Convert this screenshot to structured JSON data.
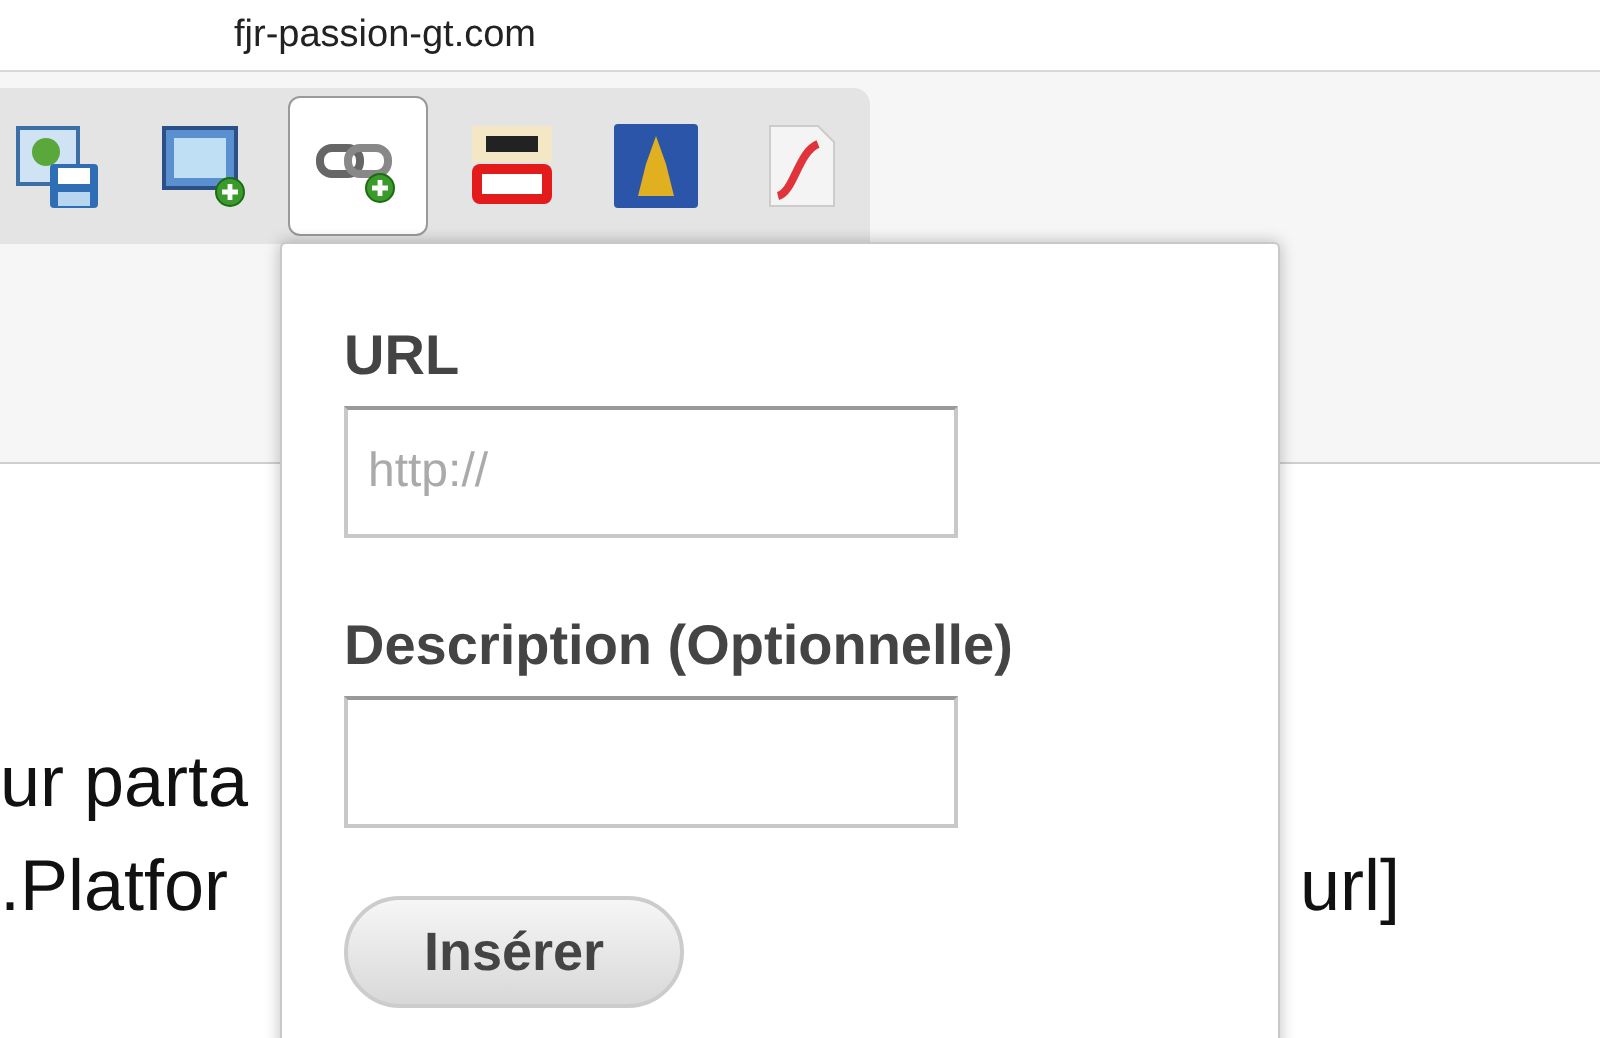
{
  "address_bar": {
    "url": "fjr-passion-gt.com"
  },
  "toolbar": {
    "tools": [
      {
        "kind": "image-save",
        "selected": false
      },
      {
        "kind": "image-add",
        "selected": false
      },
      {
        "kind": "link-add",
        "selected": true
      },
      {
        "kind": "video",
        "selected": false
      },
      {
        "kind": "tower",
        "selected": false
      },
      {
        "kind": "flash",
        "selected": false
      }
    ]
  },
  "editor": {
    "lines": [
      {
        "left": "ur parta"
      },
      {
        "left": ".Platfor",
        "right": "url]"
      }
    ]
  },
  "popup": {
    "fields": [
      {
        "label": "URL",
        "placeholder": "http://"
      },
      {
        "label": "Description (Optionnelle)"
      }
    ],
    "button": "Insérer"
  }
}
